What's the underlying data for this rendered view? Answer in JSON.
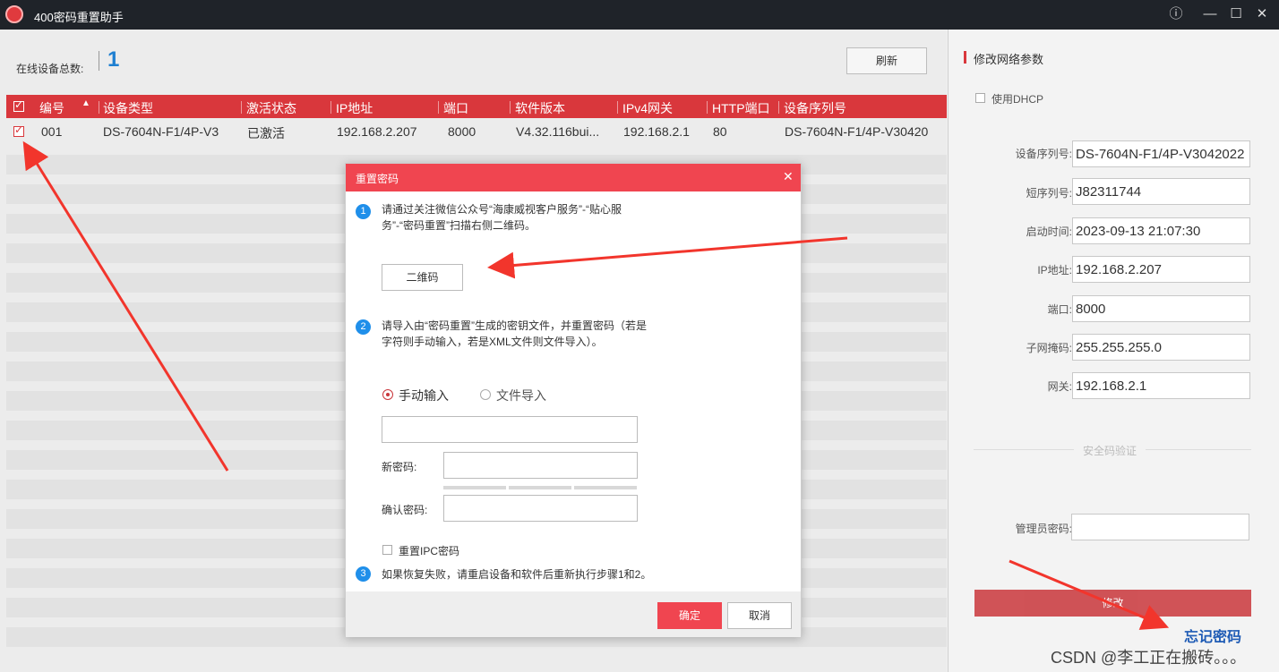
{
  "window": {
    "title": "400密码重置助手",
    "info_icon": "info-icon",
    "min_icon": "minimize-icon",
    "max_icon": "maximize-icon",
    "close_icon": "close-icon"
  },
  "main": {
    "total_label": "在线设备总数:",
    "total_count": "1",
    "refresh_label": "刷新",
    "columns": [
      "编号",
      "设备类型",
      "激活状态",
      "IP地址",
      "端口",
      "软件版本",
      "IPv4网关",
      "HTTP端口",
      "设备序列号"
    ],
    "rows": [
      {
        "checked": true,
        "id": "001",
        "type": "DS-7604N-F1/4P-V3",
        "status": "已激活",
        "ip": "192.168.2.207",
        "port": "8000",
        "version": "V4.32.116bui...",
        "gateway": "192.168.2.1",
        "http_port": "80",
        "serial": "DS-7604N-F1/4P-V30420"
      }
    ]
  },
  "panel": {
    "heading": "修改网络参数",
    "dhcp_label": "使用DHCP",
    "fields": [
      {
        "label": "设备序列号:",
        "value": "DS-7604N-F1/4P-V3042022"
      },
      {
        "label": "短序列号:",
        "value": "J82311744"
      },
      {
        "label": "启动时间:",
        "value": "2023-09-13 21:07:30"
      },
      {
        "label": "IP地址:",
        "value": "192.168.2.207"
      },
      {
        "label": "端口:",
        "value": "8000"
      },
      {
        "label": "子网掩码:",
        "value": "255.255.255.0"
      },
      {
        "label": "网关:",
        "value": "192.168.2.1"
      }
    ],
    "security_divider": "安全码验证",
    "admin_password_label": "管理员密码:",
    "modify_label": "修改",
    "forget_password": "忘记密码"
  },
  "dialog": {
    "title": "重置密码",
    "step1": "1",
    "step1_text_line1": "请通过关注微信公众号“海康威视客户服务”-“贴心服",
    "step1_text_line2": "务”-“密码重置”扫描右侧二维码。",
    "qr_button": "二维码",
    "step2": "2",
    "step2_text_line1": "请导入由“密码重置”生成的密钥文件，并重置密码（若是",
    "step2_text_line2": "字符则手动输入，若是XML文件则文件导入）。",
    "radio_manual": "手动输入",
    "radio_file": "文件导入",
    "new_password_label": "新密码:",
    "confirm_password_label": "确认密码:",
    "reset_ipc_label": "重置IPC密码",
    "step3": "3",
    "step3_text": "如果恢复失败，请重启设备和软件后重新执行步骤1和2。",
    "ok_label": "确定",
    "cancel_label": "取消"
  },
  "watermark": "CSDN @李工正在搬砖。。。",
  "colors": {
    "accent_red": "#d9373c",
    "dialog_red": "#f04550",
    "step_blue": "#1f8fea",
    "annotation_arrow": "#f2352c"
  }
}
